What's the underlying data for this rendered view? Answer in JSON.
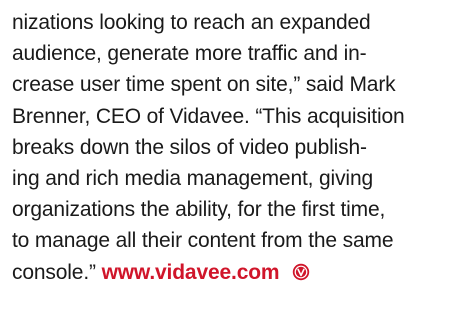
{
  "article": {
    "lines": [
      "nizations looking to reach an expanded",
      "audience, generate more traffic and in-",
      "crease user time spent on site,” said Mark",
      "Brenner, CEO of Vidavee. “This acquisition",
      "breaks down the silos of video publish-",
      "ing and rich media management, giving",
      "organizations the ability, for the first time,",
      "to manage all their content from the same"
    ],
    "last_line_text": "console.”",
    "link_text": "www.vidavee.com",
    "end_mark_icon": "publication-end-mark-icon",
    "link_color": "#d0152a",
    "text_color": "#1a1a1a"
  }
}
